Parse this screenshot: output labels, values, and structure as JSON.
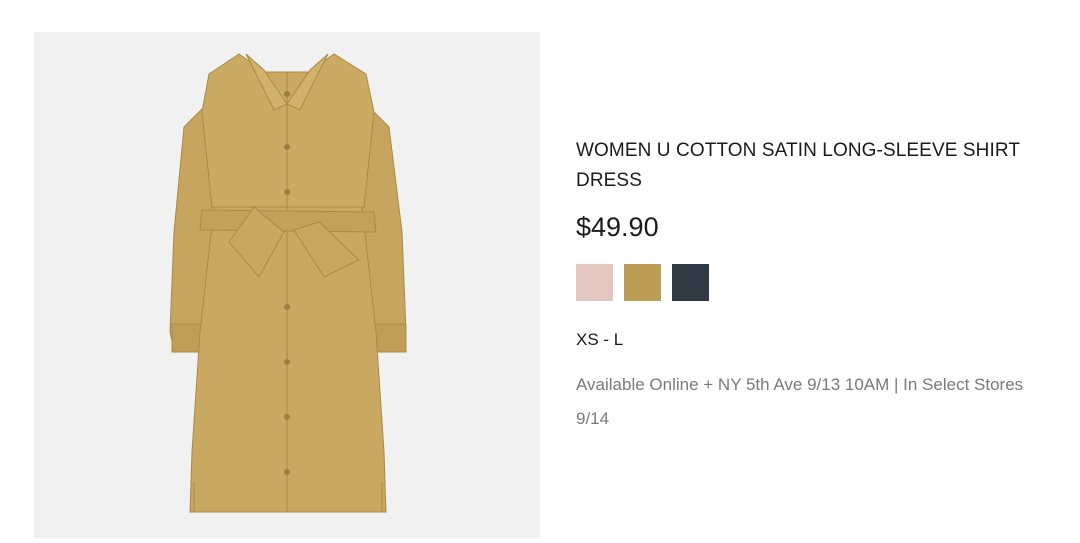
{
  "product": {
    "title": "WOMEN U COTTON SATIN LONG-SLEEVE SHIRT DRESS",
    "price": "$49.90",
    "sizes": "XS - L",
    "availability": "Available Online + NY 5th Ave 9/13 10AM | In Select Stores 9/14",
    "image_alt": "khaki shirt dress",
    "swatches": [
      {
        "name": "pink",
        "color": "#e3c6c0"
      },
      {
        "name": "khaki",
        "color": "#bb9d55"
      },
      {
        "name": "dark-navy",
        "color": "#2f3a44"
      }
    ]
  },
  "colors": {
    "image_background": "#f1f1f1",
    "dress": "#c9a962",
    "dress_shadow": "#a98a45",
    "text_muted": "#7a7a7a"
  }
}
